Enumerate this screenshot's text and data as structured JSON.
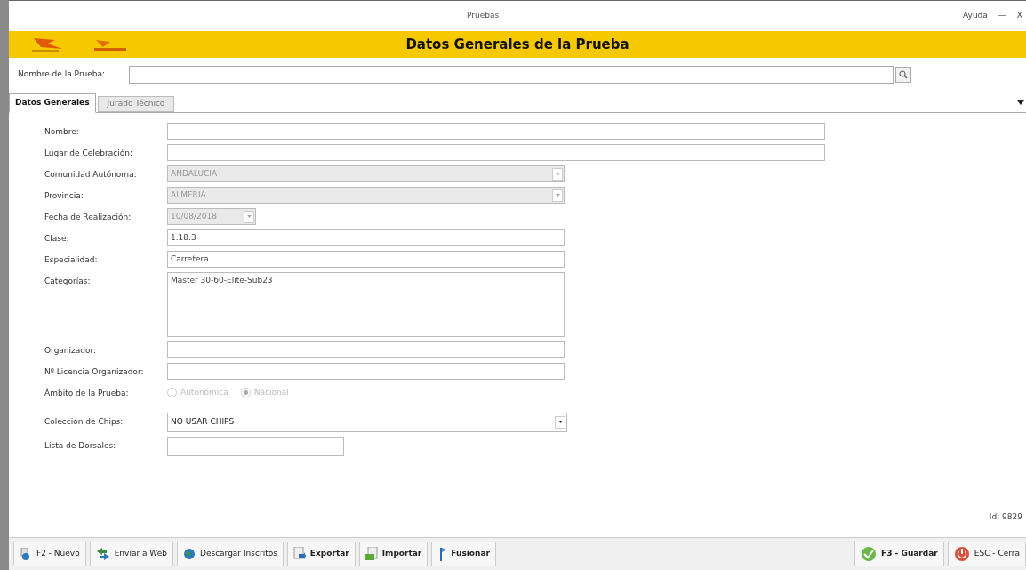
{
  "window": {
    "title": "Pruebas",
    "menu": "Ayuda",
    "controls": [
      "—",
      "X"
    ]
  },
  "header": {
    "title": "Datos Generales de la Prueba"
  },
  "search": {
    "label": "Nombre de la Prueba:"
  },
  "tabs": [
    {
      "label": "Datos Generales",
      "selected": true
    },
    {
      "label": "Jurado Técnico",
      "selected": false
    }
  ],
  "fields": [
    {
      "kind": "text",
      "label": "Nombre:",
      "disabled": false
    },
    {
      "kind": "text",
      "label": "Lugar de Celebración:",
      "disabled": false
    },
    {
      "kind": "combo",
      "label": "Comunidad Autónoma:",
      "value": "ANDALUCIA",
      "disabled": true
    },
    {
      "kind": "combo",
      "label": "Provincia:",
      "value": "ALMERIA",
      "disabled": true
    },
    {
      "kind": "date",
      "label": "Fecha de Realización:",
      "value": "10/08/2018",
      "disabled": true
    },
    {
      "kind": "text",
      "label": "Clase:",
      "value": "1.18.3",
      "disabled": false
    },
    {
      "kind": "text",
      "label": "Especialidad:",
      "value": "Carretera",
      "disabled": false
    },
    {
      "kind": "textarea",
      "label": "Categorías:",
      "value": "Master 30-60-Elite-Sub23",
      "disabled": false
    },
    {
      "kind": "text",
      "label": "Organizador:",
      "disabled": false
    },
    {
      "kind": "text",
      "label": "Nº Licencia Organizador:",
      "disabled": false
    },
    {
      "kind": "radio",
      "label": "Ámbito de la Prueba:",
      "disabled": true,
      "options": [
        {
          "label": "Autonómica",
          "selected": false
        },
        {
          "label": "Nacional",
          "selected": true
        }
      ]
    },
    {
      "kind": "combo",
      "label": "Colección de Chips:",
      "value": "NO USAR CHIPS",
      "disabled": false,
      "wide": true
    },
    {
      "kind": "short",
      "label": "Lista de Dorsales:",
      "disabled": false
    }
  ],
  "record_id": "Id: 9829",
  "toolbar_left": [
    {
      "label": "F2 - Nuevo",
      "bold": false
    },
    {
      "label": "Enviar a Web",
      "bold": false
    },
    {
      "label": "Descargar Inscritos",
      "bold": false
    },
    {
      "label": "Exportar",
      "bold": true
    },
    {
      "label": "Importar",
      "bold": true
    },
    {
      "label": "Fusionar",
      "bold": true
    }
  ],
  "toolbar_right": [
    {
      "label": "F3 - Guardar",
      "bold": true
    },
    {
      "label": "ESC - Cerra",
      "bold": false
    }
  ]
}
